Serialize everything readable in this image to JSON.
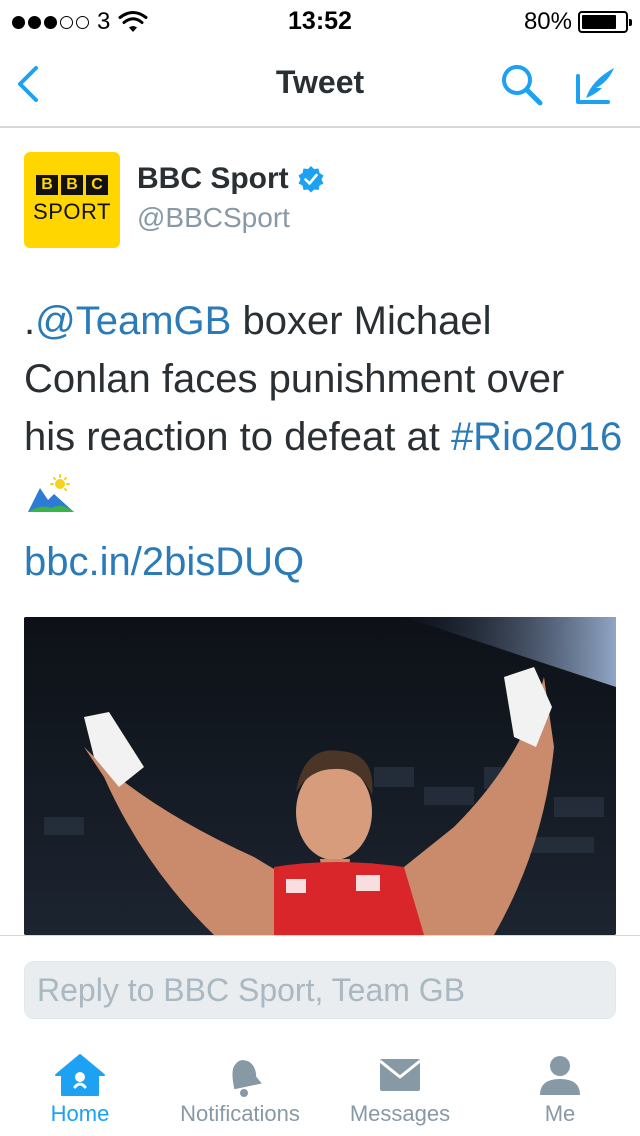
{
  "status_bar": {
    "carrier": "3",
    "time": "13:52",
    "battery": "80%",
    "battery_level": 0.8
  },
  "nav": {
    "title": "Tweet",
    "back_icon": "chevron-left-icon",
    "search_icon": "search-icon",
    "compose_icon": "compose-tweet-icon"
  },
  "tweet": {
    "avatar": {
      "bbc_letters": [
        "B",
        "B",
        "C"
      ],
      "sport_word": "SPORT"
    },
    "author_name": "BBC Sport",
    "author_handle": "@BBCSport",
    "text": {
      "prefix": ".",
      "mention": "@TeamGB",
      "body": " boxer Michael Conlan faces punishment over his reaction to defeat at ",
      "hashtag": "#Rio2016"
    },
    "link": "bbc.in/2bisDUQ"
  },
  "reply": {
    "placeholder": "Reply to BBC Sport, Team GB"
  },
  "tabs": [
    {
      "label": "Home",
      "icon": "home-icon",
      "active": true
    },
    {
      "label": "Notifications",
      "icon": "bell-icon",
      "active": false
    },
    {
      "label": "Messages",
      "icon": "envelope-icon",
      "active": false
    },
    {
      "label": "Me",
      "icon": "person-icon",
      "active": false
    }
  ],
  "colors": {
    "accent": "#1da1f2",
    "link": "#2b7bb9",
    "text": "#292f33",
    "secondary_text": "#8899a6",
    "bbc_yellow": "#ffd600"
  }
}
